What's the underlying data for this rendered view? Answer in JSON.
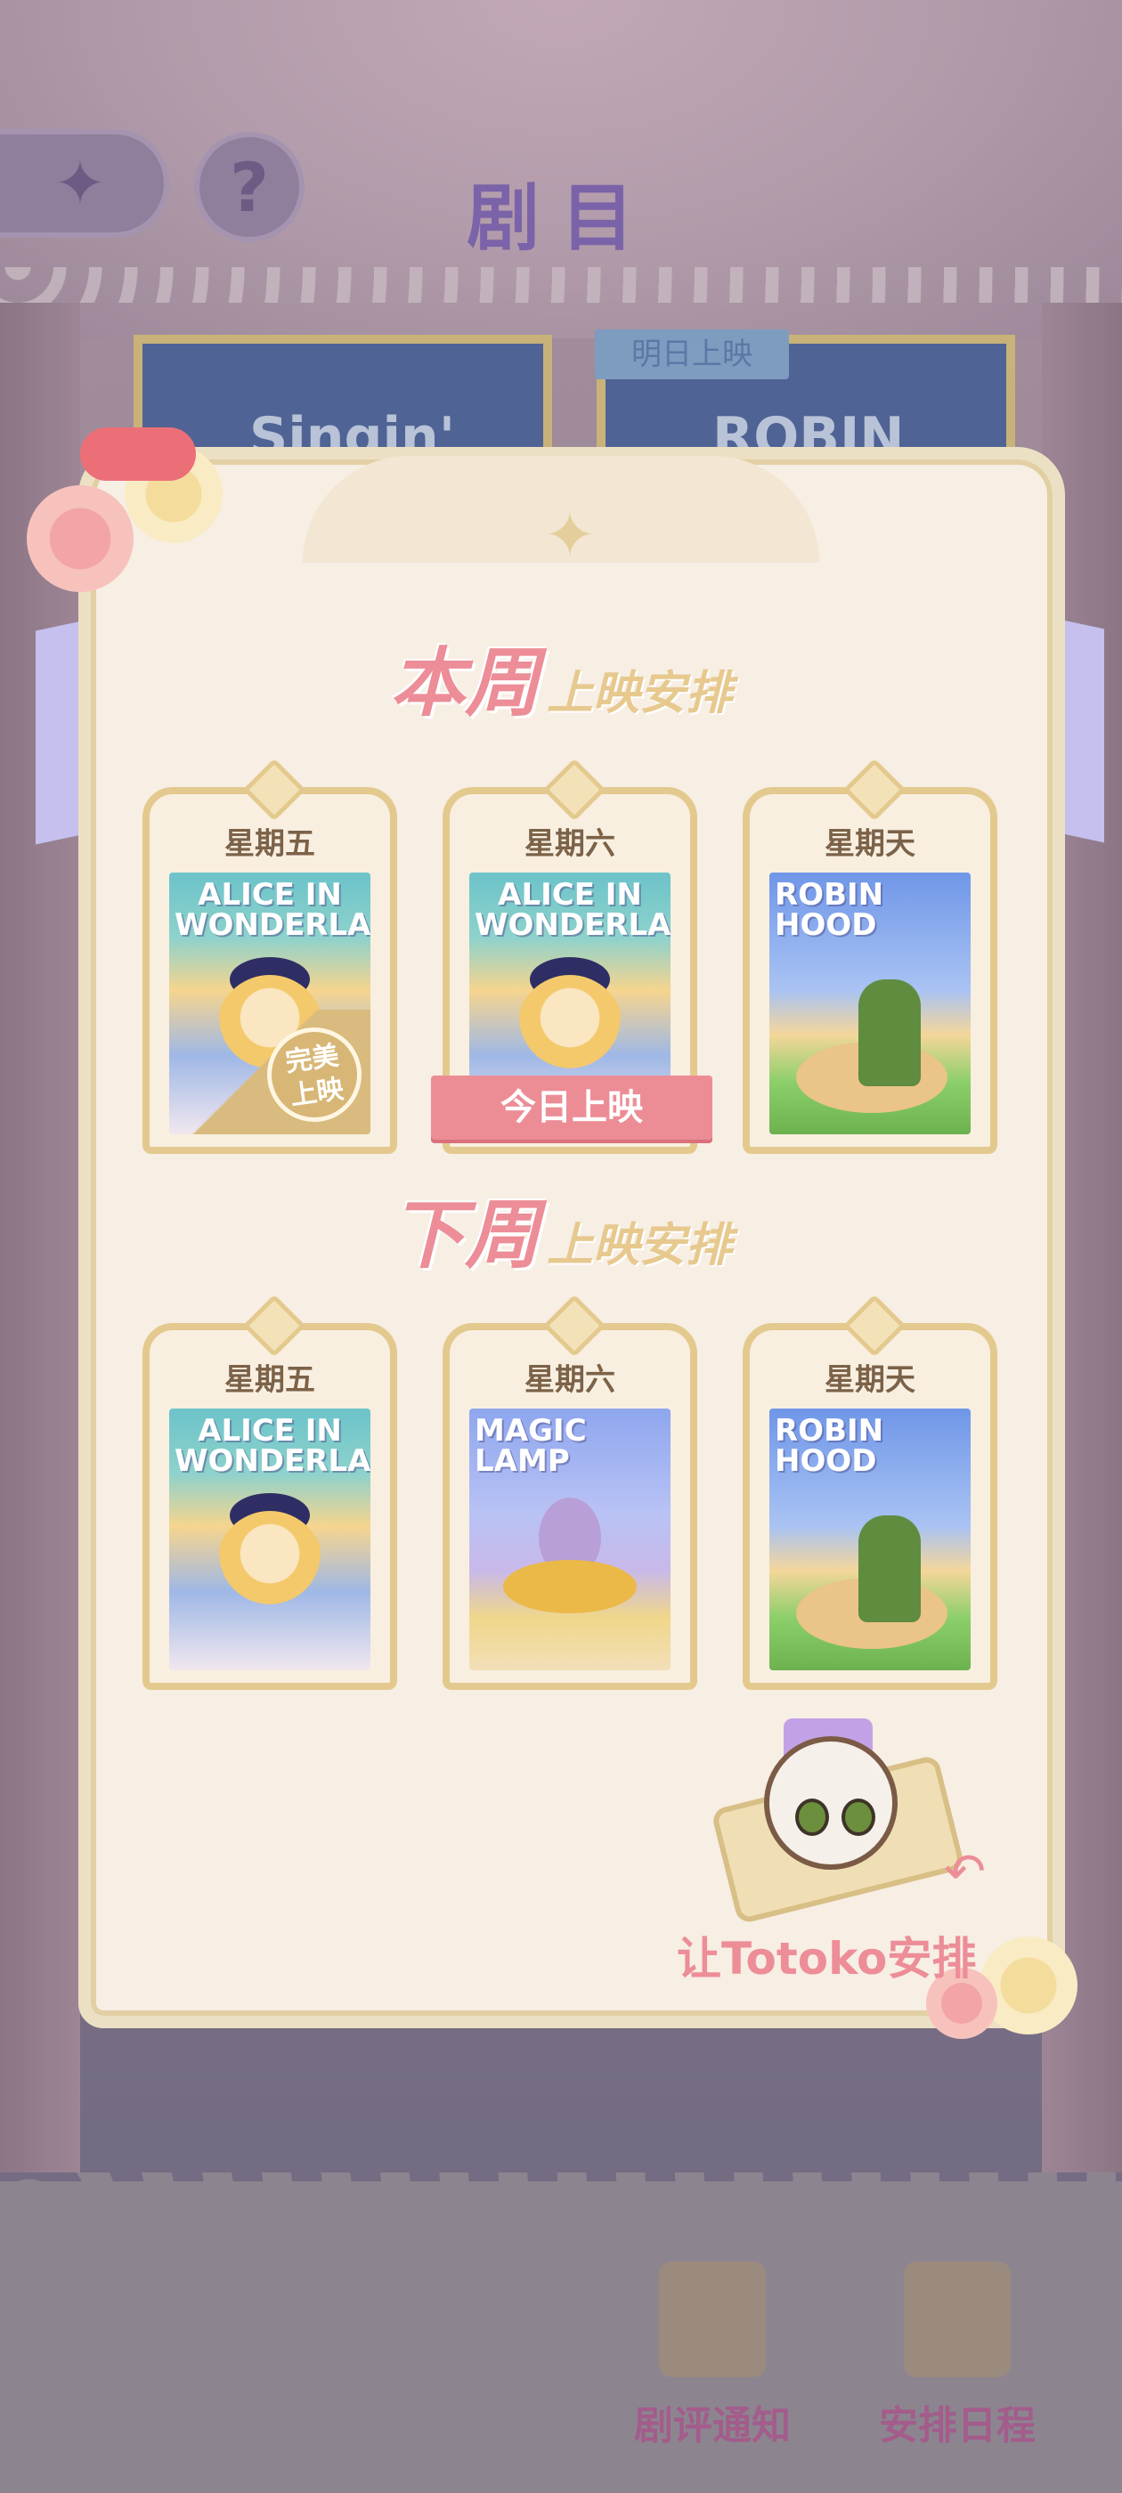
{
  "header": {
    "title": "剧目",
    "back_icon": "back-diamond-icon",
    "help_icon": "?"
  },
  "background": {
    "poster_left_title": "Singin'",
    "poster_right_title": "ROBIN",
    "tomorrow_tag": "明日上映"
  },
  "this_week": {
    "title_big": "本周",
    "title_small": "上映安排",
    "cards": [
      {
        "day": "星期五",
        "poster": "ALICE IN WONDERLAND",
        "badge": "完美\n上映"
      },
      {
        "day": "星期六",
        "poster": "ALICE IN WONDERLAND",
        "banner": "今日上映"
      },
      {
        "day": "星期天",
        "poster": "ROBIN HOOD"
      }
    ]
  },
  "next_week": {
    "title_big": "下周",
    "title_small": "上映安排",
    "cards": [
      {
        "day": "星期五",
        "poster": "ALICE IN WONDERLAND"
      },
      {
        "day": "星期六",
        "poster": "MAGIC LAMP"
      },
      {
        "day": "星期天",
        "poster": "ROBIN HOOD"
      }
    ]
  },
  "totoko": {
    "label": "让Totoko安排",
    "icon": "totoko-cat-icon"
  },
  "bottom_nav": [
    {
      "label": "剧评通知",
      "icon": "review-scroll-icon"
    },
    {
      "label": "安排日程",
      "icon": "schedule-board-icon"
    }
  ],
  "colors": {
    "accent_pink": "#ec8d98",
    "gold": "#e4c98e",
    "title_purple": "#7a63a8",
    "nav_label": "#a35c8b"
  }
}
